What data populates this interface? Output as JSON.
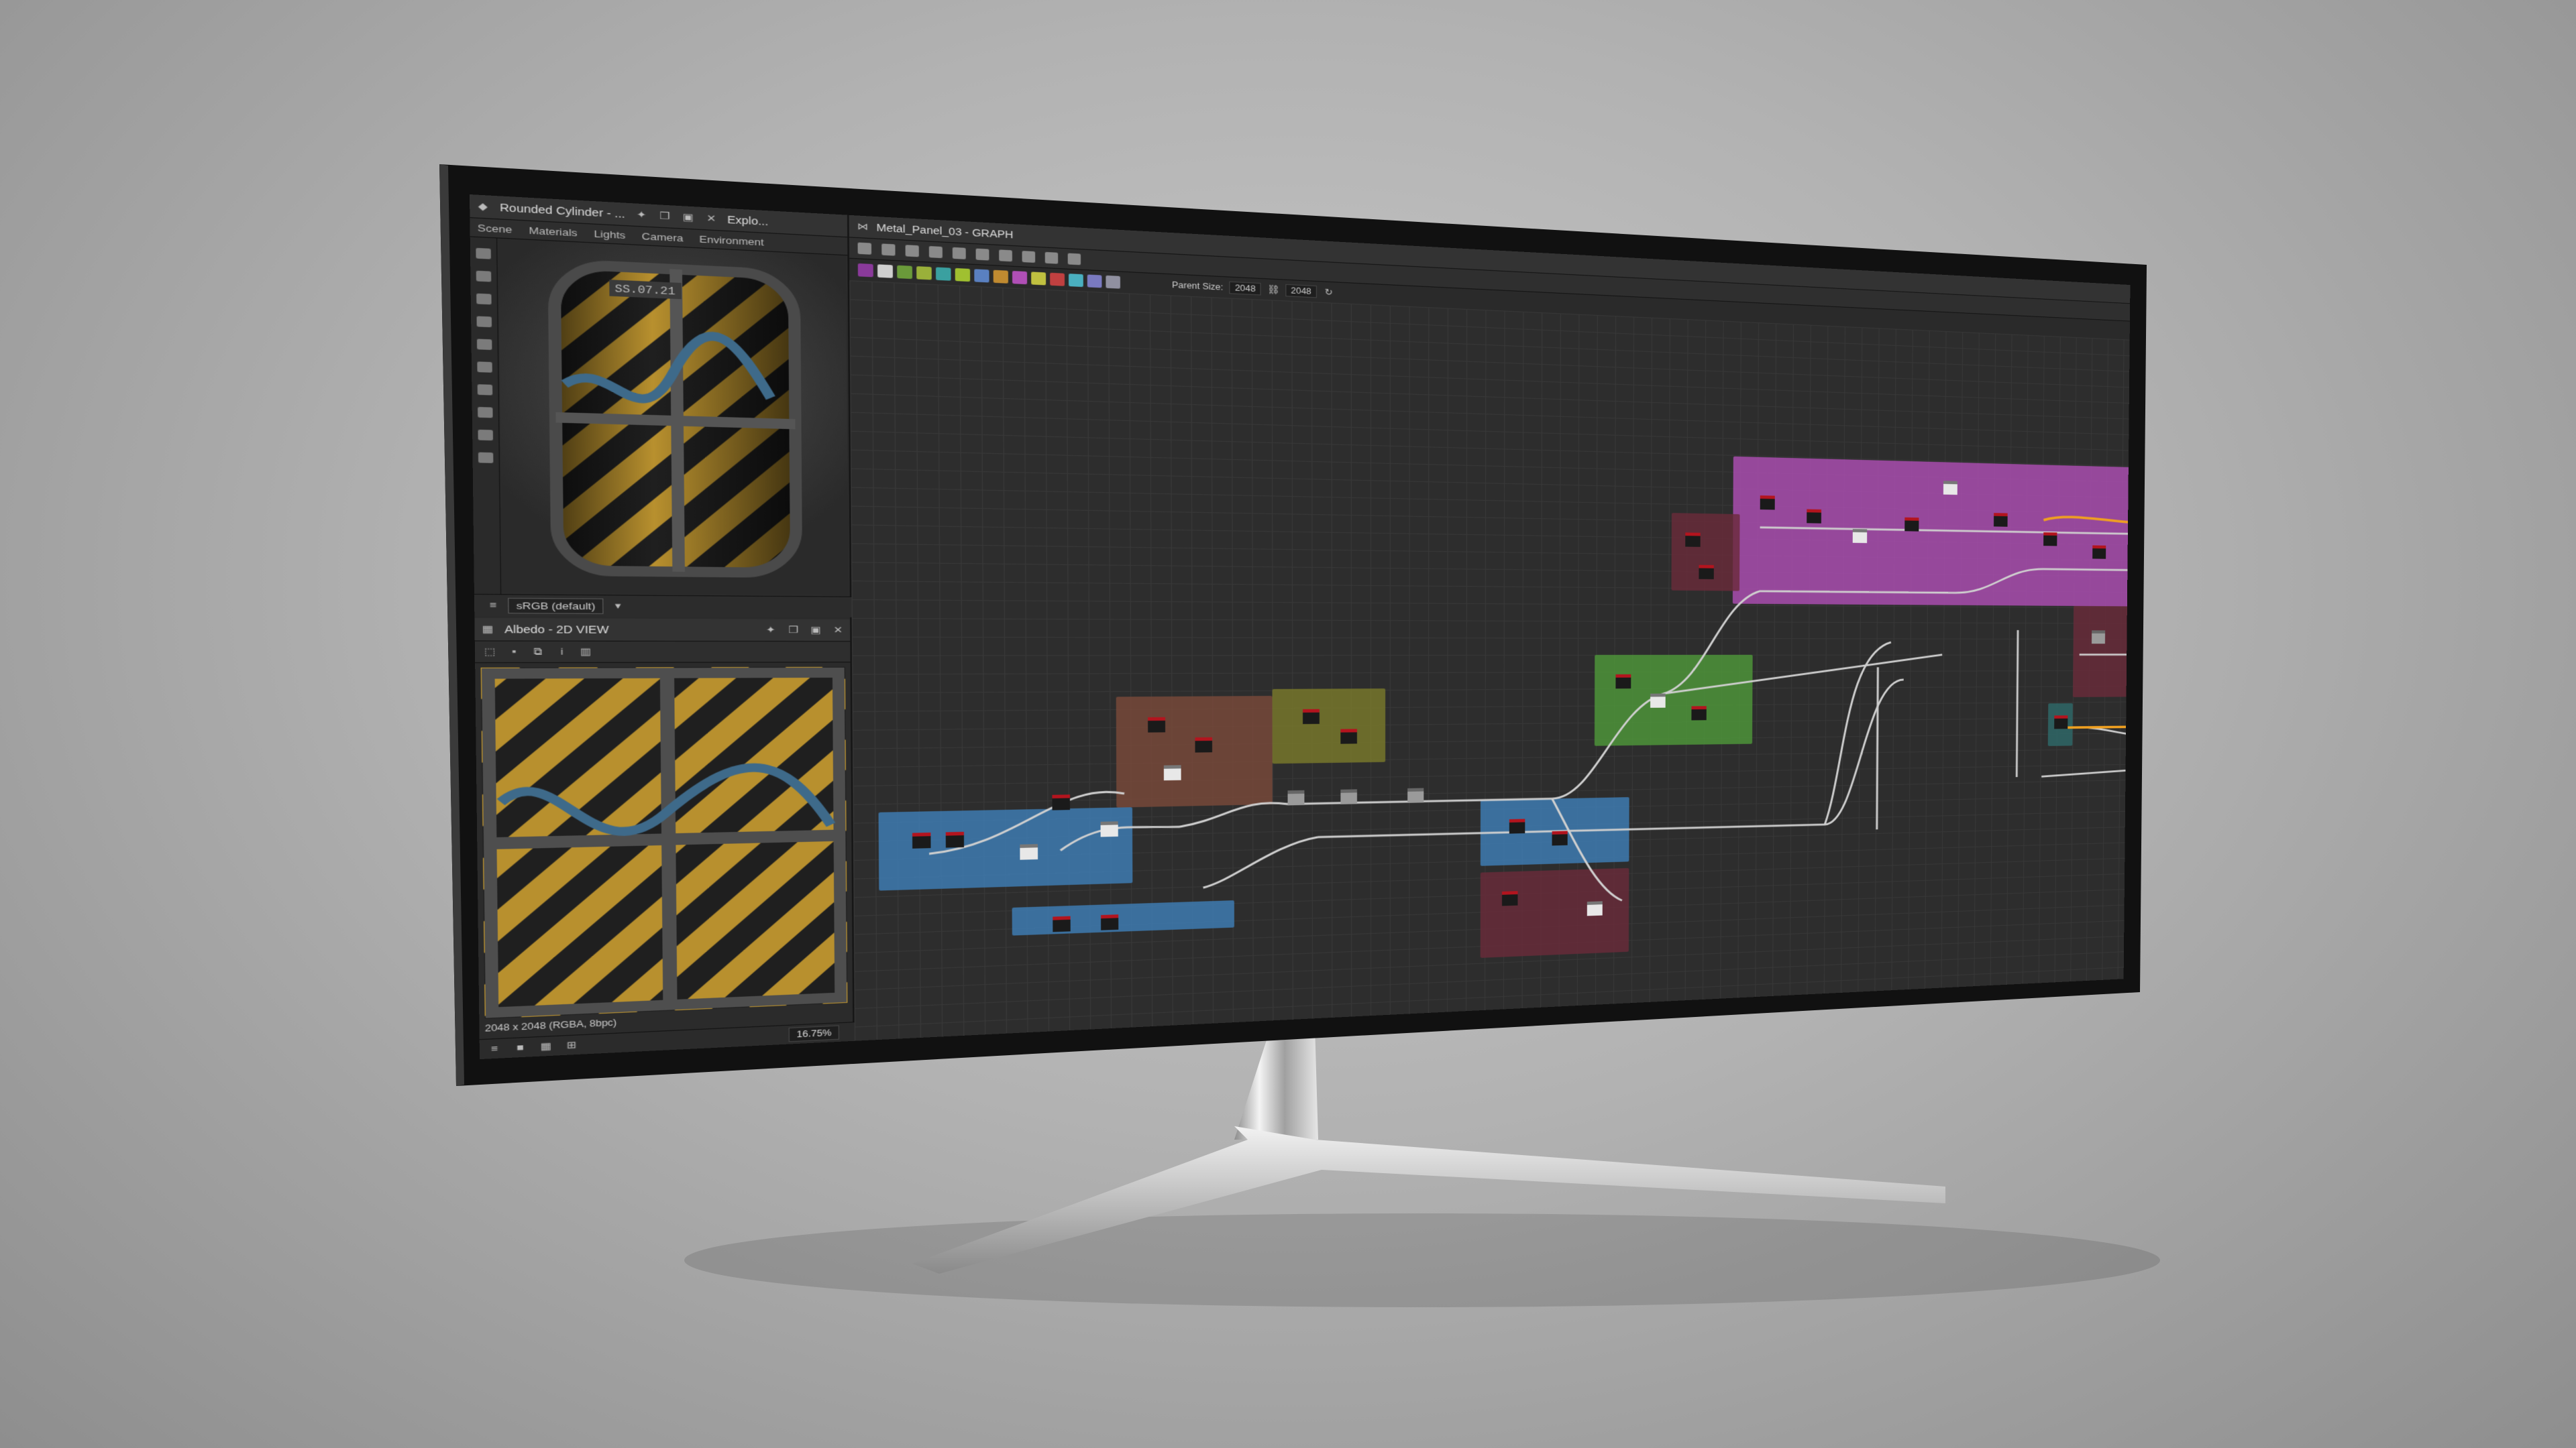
{
  "left_panel": {
    "scene_tab": "Rounded Cylinder - ...",
    "explorer_tab": "Explo...",
    "tabs": [
      "Scene",
      "Materials",
      "Lights",
      "Camera",
      "Environment"
    ],
    "decal_text": "SS.07.21",
    "colorspace": "sRGB (default)"
  },
  "view2d": {
    "title": "Albedo - 2D VIEW",
    "status": "2048 x 2048 (RGBA, 8bpc)",
    "zoom": "16.75%"
  },
  "graph": {
    "title": "Metal_Panel_03 - GRAPH",
    "parent_size_label": "Parent Size:",
    "parent_size_value": "2048",
    "size_value": "2048"
  },
  "colors": {
    "frame_purple": "#b04fb6",
    "frame_blue": "#3f7fb9",
    "frame_green": "#4f9a3a",
    "frame_brown": "#7a4a3a",
    "frame_olive": "#7a7a2a",
    "frame_maroon": "#6a2a3a",
    "frame_teal": "#2e6a6a",
    "node_red": "#b3141e",
    "wire": "#cfcfcf",
    "wire_orange": "#f0a020"
  },
  "icons": [
    "pin-icon",
    "restore-icon",
    "maximize-icon",
    "close-icon",
    "search-icon",
    "info-icon",
    "histogram-icon",
    "grid-icon",
    "lock-icon"
  ]
}
